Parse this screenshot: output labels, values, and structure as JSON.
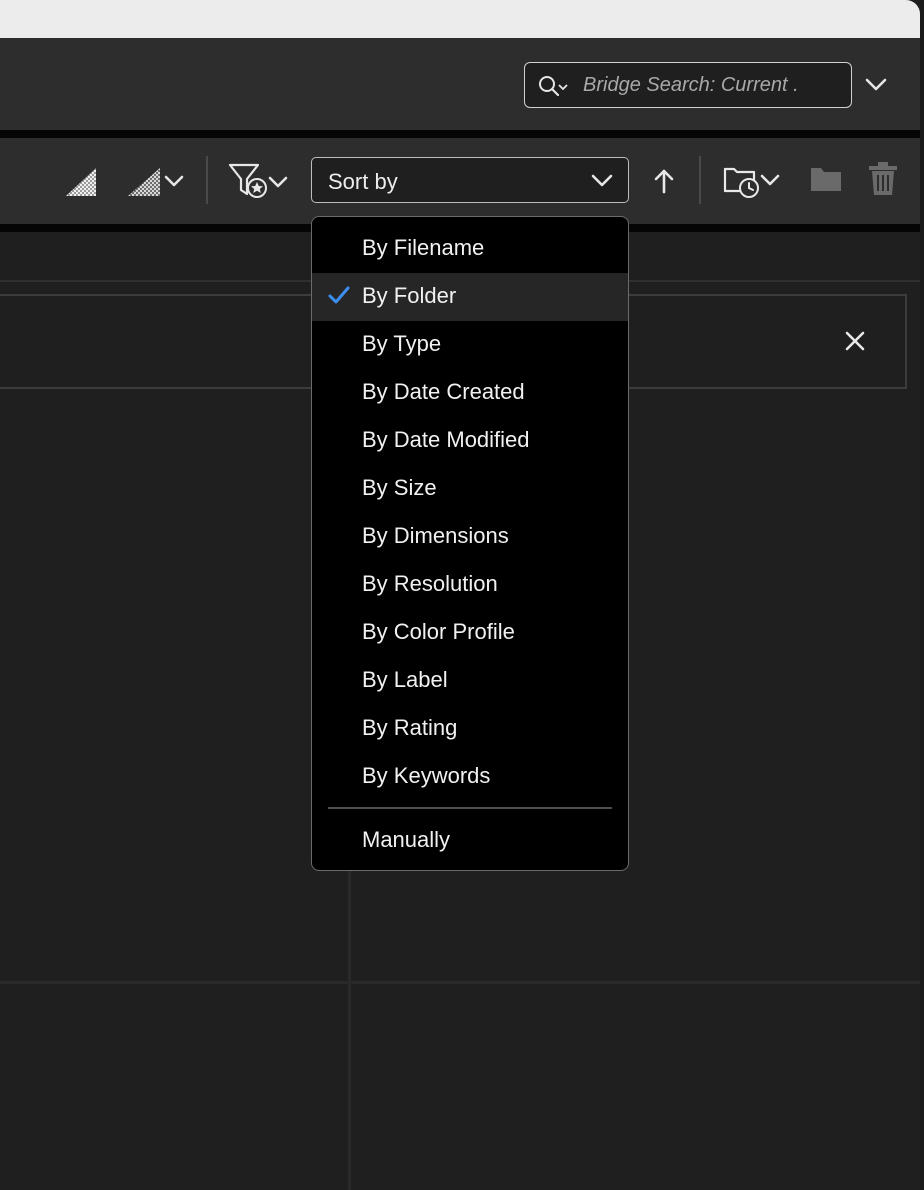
{
  "search": {
    "placeholder": "Bridge Search: Current ."
  },
  "toolbar": {
    "sort_label": "Sort by",
    "icons": [
      "thumbnail-quality-icon",
      "thumbnail-quality-dropdown-icon",
      "filter-favorites-icon",
      "sort-ascending-icon",
      "recent-folders-icon",
      "new-folder-icon",
      "delete-icon"
    ]
  },
  "sort_menu": {
    "items": [
      {
        "label": "By Filename",
        "selected": false
      },
      {
        "label": "By Folder",
        "selected": true
      },
      {
        "label": "By Type",
        "selected": false
      },
      {
        "label": "By Date Created",
        "selected": false
      },
      {
        "label": "By Date Modified",
        "selected": false
      },
      {
        "label": "By Size",
        "selected": false
      },
      {
        "label": "By Dimensions",
        "selected": false
      },
      {
        "label": "By Resolution",
        "selected": false
      },
      {
        "label": "By Color Profile",
        "selected": false
      },
      {
        "label": "By Label",
        "selected": false
      },
      {
        "label": "By Rating",
        "selected": false
      },
      {
        "label": "By Keywords",
        "selected": false
      }
    ],
    "manual_label": "Manually"
  },
  "colors": {
    "accent_check": "#3b8ff0",
    "background": "#1f1f1f",
    "panel": "#2d2d2d",
    "menu": "#000000"
  }
}
